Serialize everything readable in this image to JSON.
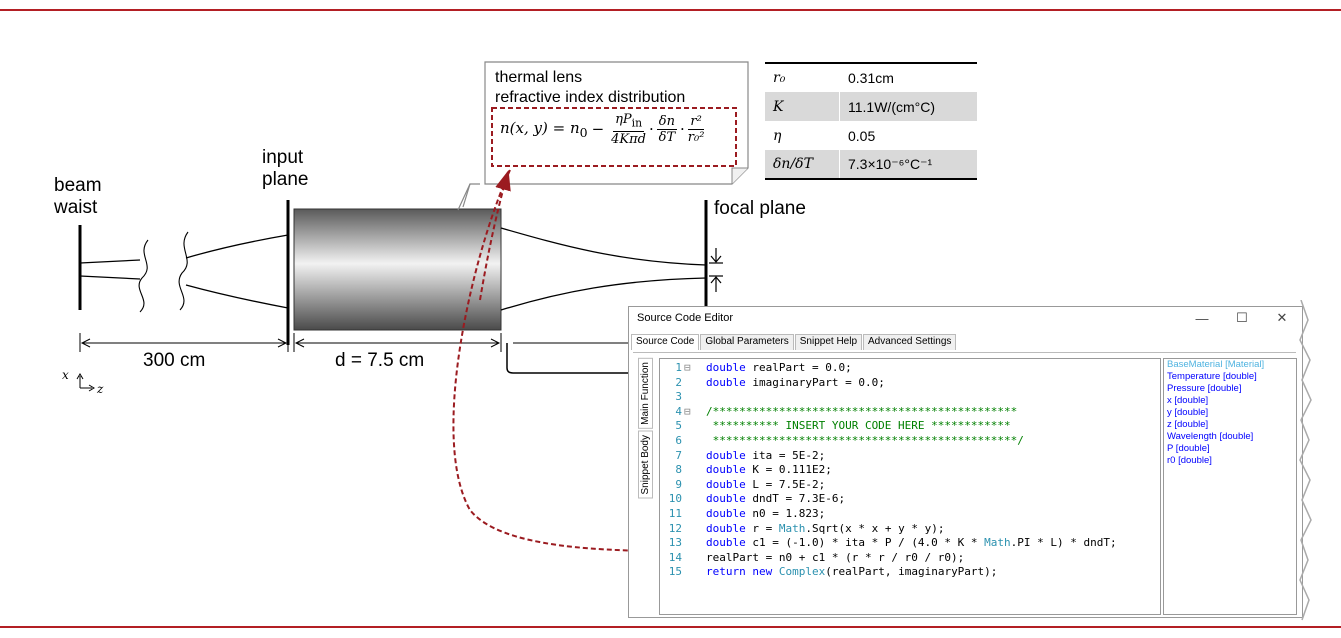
{
  "labels": {
    "beam_waist": [
      "beam",
      "waist"
    ],
    "input_plane": [
      "input",
      "plane"
    ],
    "focal_plane": "focal plane",
    "distance_300": "300 cm",
    "crystal_length": "d = 7.5 cm",
    "axis_x": "x",
    "axis_z": "z"
  },
  "callout": {
    "line1": "thermal lens",
    "line2": "refractive index distribution",
    "formula_lhs": "n(x, y) = n",
    "formula_sub0": "0",
    "minus": "−",
    "frac1_num": "ηP",
    "frac1_num_sub": "in",
    "frac1_den": "4Kπd",
    "frac2_num": "δn",
    "frac2_den": "δT",
    "frac3_num": "r²",
    "frac3_den": "r₀²"
  },
  "params": [
    {
      "symbol": "r₀",
      "value": "0.31cm"
    },
    {
      "symbol": "K",
      "value": "11.1W/(cm°C)"
    },
    {
      "symbol": "η",
      "value": "0.05"
    },
    {
      "symbol": "δn/δT",
      "value": "7.3×10⁻⁶°C⁻¹"
    }
  ],
  "editor": {
    "title": "Source Code Editor",
    "min": "—",
    "max": "☐",
    "close": "✕",
    "tabs": [
      "Source Code",
      "Global Parameters",
      "Snippet Help",
      "Advanced Settings"
    ],
    "vtabs": [
      "Main Function",
      "Snippet Body"
    ],
    "code_lines": [
      "double realPart = 0.0;",
      "double imaginaryPart = 0.0;",
      "",
      "/**********************************************",
      " ********** INSERT YOUR CODE HERE ************",
      " **********************************************/",
      "double ita = 5E-2;",
      "double K = 0.111E2;",
      "double L = 7.5E-2;",
      "double dndT = 7.3E-6;",
      "double n0 = 1.823;",
      "double r = Math.Sqrt(x * x + y * y);",
      "double c1 = (-1.0) * ita * P / (4.0 * K * Math.PI * L) * dndT;",
      "realPart = n0 + c1 * (r * r / r0 / r0);",
      "return new Complex(realPart, imaginaryPart);"
    ],
    "variables": [
      "BaseMaterial [Material]",
      "Temperature [double]",
      "Pressure [double]",
      "x [double]",
      "y [double]",
      "z [double]",
      "Wavelength [double]",
      "P [double]",
      "r0 [double]"
    ]
  },
  "colors": {
    "accent": "#b31f24",
    "keyword": "#0000ff",
    "comment": "#008000",
    "type": "#2b91af"
  }
}
